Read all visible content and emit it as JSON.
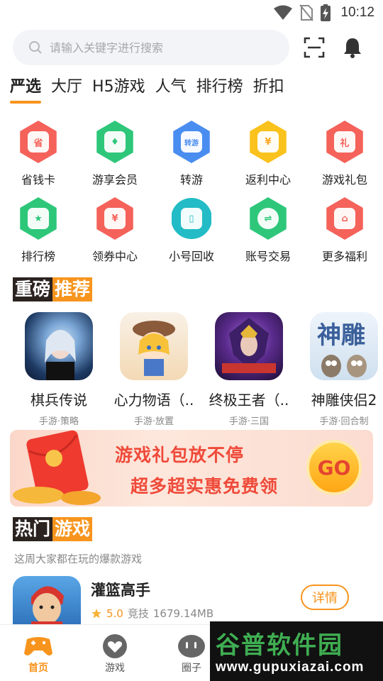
{
  "status_bar": {
    "time": "10:12",
    "icons": [
      "wifi-icon",
      "no-sim-icon",
      "battery-charging-icon"
    ]
  },
  "search": {
    "placeholder": "请输入关键字进行搜索",
    "value": "",
    "icons": [
      "search-icon",
      "scan-icon",
      "bell-icon"
    ]
  },
  "top_tabs": [
    {
      "label": "严选",
      "active": true
    },
    {
      "label": "大厅",
      "active": false
    },
    {
      "label": "H5游戏",
      "active": false
    },
    {
      "label": "人气",
      "active": false
    },
    {
      "label": "排行榜",
      "active": false
    },
    {
      "label": "折扣",
      "active": false
    }
  ],
  "features": [
    {
      "label": "省钱卡",
      "icon": "money-card-icon",
      "color": "#f4625a",
      "glyph": "省"
    },
    {
      "label": "游享会员",
      "icon": "vip-diamond-icon",
      "color": "#2ec77a",
      "glyph": "♦"
    },
    {
      "label": "转游",
      "icon": "transfer-icon",
      "color": "#4a8df0",
      "glyph": "转游"
    },
    {
      "label": "返利中心",
      "icon": "rebate-icon",
      "color": "#f9c21c",
      "glyph": "¥"
    },
    {
      "label": "游戏礼包",
      "icon": "gift-pack-icon",
      "color": "#f4625a",
      "glyph": "礼"
    },
    {
      "label": "排行榜",
      "icon": "trophy-icon",
      "color": "#2ec77a",
      "glyph": "★"
    },
    {
      "label": "领券中心",
      "icon": "coupon-icon",
      "color": "#f4625a",
      "glyph": "¥"
    },
    {
      "label": "小号回收",
      "icon": "phone-recycle-icon",
      "color": "#23bcc6",
      "glyph": "▯"
    },
    {
      "label": "账号交易",
      "icon": "account-trade-icon",
      "color": "#2ec77a",
      "glyph": "⇌"
    },
    {
      "label": "更多福利",
      "icon": "more-welfare-icon",
      "color": "#f4625a",
      "glyph": "⌂"
    }
  ],
  "featured": {
    "title_a": "重磅",
    "title_b": "推荐",
    "games": [
      {
        "name": "棋兵传说",
        "tags": "手游·策略"
      },
      {
        "name": "心力物语（..",
        "tags": "手游·放置"
      },
      {
        "name": "终极王者（..",
        "tags": "手游·三国"
      },
      {
        "name": "神雕侠侣2",
        "tags": "手游·回合制"
      }
    ]
  },
  "banner": {
    "line1": "游戏礼包放不停",
    "line2": "超多超实惠免费领",
    "go": "GO"
  },
  "hot": {
    "title_a": "热门",
    "title_b": "游戏",
    "subtitle": "这周大家都在玩的爆款游戏",
    "items": [
      {
        "name": "灌篮高手",
        "rating": "5.0",
        "genre": "竞技",
        "size": "1679.14MB",
        "action": "详情"
      }
    ]
  },
  "bottom_nav": [
    {
      "label": "首页",
      "icon": "home-gamepad-icon",
      "active": true
    },
    {
      "label": "游戏",
      "icon": "games-heart-icon",
      "active": false
    },
    {
      "label": "圈子",
      "icon": "community-icon",
      "active": false
    }
  ],
  "watermark": {
    "title": "谷普软件园",
    "url": "www.gupuxiazai.com"
  },
  "colors": {
    "accent": "#f7941d",
    "dark_title_bg": "#2b2320",
    "banner_text": "#ef4a3a"
  }
}
